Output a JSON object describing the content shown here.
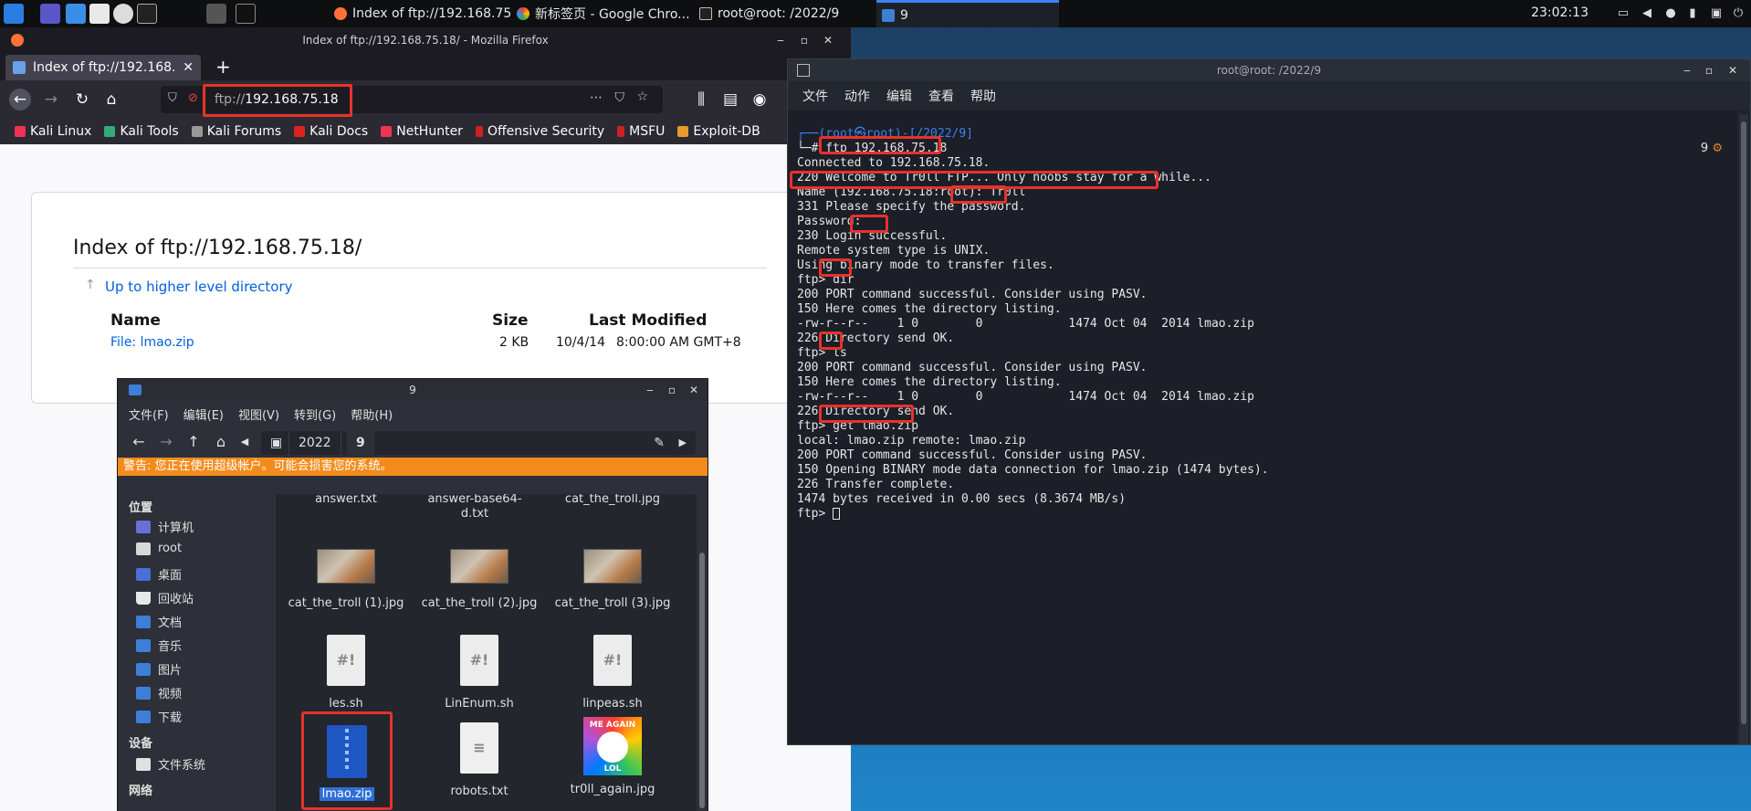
{
  "taskbar": {
    "tasks": [
      "Index of ftp://192.168.75...",
      "新标签页 - Google Chro...",
      "root@root: /2022/9",
      "9"
    ],
    "clock": "23:02:13"
  },
  "firefox": {
    "window_title": "Index of ftp://192.168.75.18/ - Mozilla Firefox",
    "tab_label": "Index of ftp://192.168.75.18/",
    "url_scheme": "ftp://",
    "url_host": "192.168.75.18",
    "bookmarks": [
      "Kali Linux",
      "Kali Tools",
      "Kali Forums",
      "Kali Docs",
      "NetHunter",
      "Offensive Security",
      "MSFU",
      "Exploit-DB"
    ],
    "page": {
      "title": "Index of ftp://192.168.75.18/",
      "up_link": "Up to higher level directory",
      "columns": {
        "name": "Name",
        "size": "Size",
        "modified": "Last Modified"
      },
      "rows": [
        {
          "name": "File: lmao.zip",
          "size": "2 KB",
          "date": "10/4/14",
          "time": "8:00:00 AM GMT+8"
        }
      ]
    }
  },
  "terminal": {
    "window_title": "root@root: /2022/9",
    "menu": [
      "文件",
      "动作",
      "编辑",
      "查看",
      "帮助"
    ],
    "tab_count": "9",
    "lines": [
      "┌──(root㉿root)-[/2022/9]",
      "└─# ftp 192.168.75.18",
      "Connected to 192.168.75.18.",
      "220 Welcome to Tr0ll FTP... Only noobs stay for a while...",
      "Name (192.168.75.18:root): Tr0ll",
      "331 Please specify the password.",
      "Password:",
      "230 Login successful.",
      "Remote system type is UNIX.",
      "Using binary mode to transfer files.",
      "ftp> dir",
      "200 PORT command successful. Consider using PASV.",
      "150 Here comes the directory listing.",
      "-rw-r--r--    1 0        0            1474 Oct 04  2014 lmao.zip",
      "226 Directory send OK.",
      "ftp> ls",
      "200 PORT command successful. Consider using PASV.",
      "150 Here comes the directory listing.",
      "-rw-r--r--    1 0        0            1474 Oct 04  2014 lmao.zip",
      "226 Directory send OK.",
      "ftp> get lmao.zip",
      "local: lmao.zip remote: lmao.zip",
      "200 PORT command successful. Consider using PASV.",
      "150 Opening BINARY mode data connection for lmao.zip (1474 bytes).",
      "226 Transfer complete.",
      "1474 bytes received in 0.00 secs (8.3674 MB/s)",
      "ftp> "
    ]
  },
  "filemanager": {
    "window_title": "9",
    "menu": [
      "文件(F)",
      "编辑(E)",
      "视图(V)",
      "转到(G)",
      "帮助(H)"
    ],
    "path": [
      "2022",
      "9"
    ],
    "warning": "警告: 您正在使用超级帐户。可能会损害您的系统。",
    "sidebar": {
      "places_header": "位置",
      "places": [
        "计算机",
        "root",
        "桌面",
        "回收站",
        "文档",
        "音乐",
        "图片",
        "视频",
        "下载"
      ],
      "devices_header": "设备",
      "devices": [
        "文件系统"
      ],
      "network_header": "网络"
    },
    "files": [
      {
        "name": "answer.txt",
        "kind": "text"
      },
      {
        "name": "answer-base64-d.txt",
        "kind": "text"
      },
      {
        "name": "cat_the_troll.jpg",
        "kind": "image"
      },
      {
        "name": "cat_the_troll (1).jpg",
        "kind": "image"
      },
      {
        "name": "cat_the_troll (2).jpg",
        "kind": "image"
      },
      {
        "name": "cat_the_troll (3).jpg",
        "kind": "image"
      },
      {
        "name": "les.sh",
        "kind": "script"
      },
      {
        "name": "LinEnum.sh",
        "kind": "script"
      },
      {
        "name": "linpeas.sh",
        "kind": "script"
      },
      {
        "name": "lmao.zip",
        "kind": "archive",
        "selected": true
      },
      {
        "name": "robots.txt",
        "kind": "text"
      },
      {
        "name": "tr0ll_again.jpg",
        "kind": "image",
        "thumb_text": [
          "ME AGAIN",
          "LOL"
        ]
      }
    ]
  },
  "colors": {
    "highlight": "#e8322a",
    "warning": "#f38b1c",
    "selection": "#2f6fd6"
  }
}
